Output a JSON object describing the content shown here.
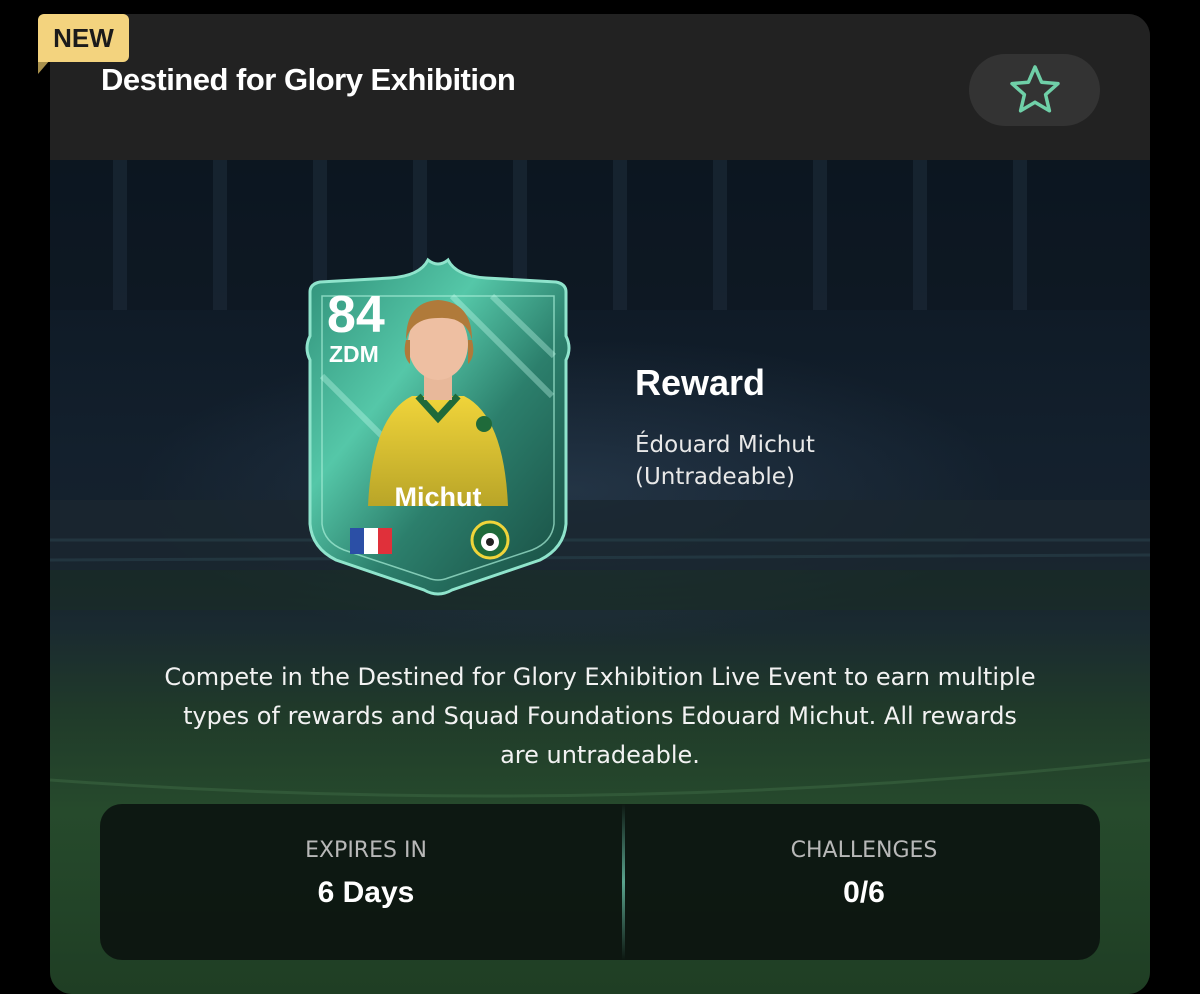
{
  "badge": {
    "label": "NEW"
  },
  "header": {
    "title": "Destined for Glory Exhibition",
    "favorite_icon": "star-outline-icon"
  },
  "card": {
    "rating": "84",
    "position": "ZDM",
    "name": "Michut",
    "nation_icon": "france-flag-icon",
    "club_icon": "club-crest-icon",
    "accent_color": "#3fbf9c"
  },
  "reward": {
    "title": "Reward",
    "player": "Édouard Michut",
    "note": "(Untradeable)"
  },
  "description": {
    "line1": "Compete in the Destined for Glory Exhibition Live Event to earn multiple",
    "line2": "types of rewards and Squad Foundations Edouard Michut. All rewards",
    "line3": "are untradeable."
  },
  "stats": {
    "expires_label": "EXPIRES IN",
    "expires_value": "6 Days",
    "challenges_label": "CHALLENGES",
    "challenges_value": "0/6"
  },
  "colors": {
    "badge": "#f3d37e",
    "accent": "#6fd0a8",
    "panel": "#222222"
  }
}
